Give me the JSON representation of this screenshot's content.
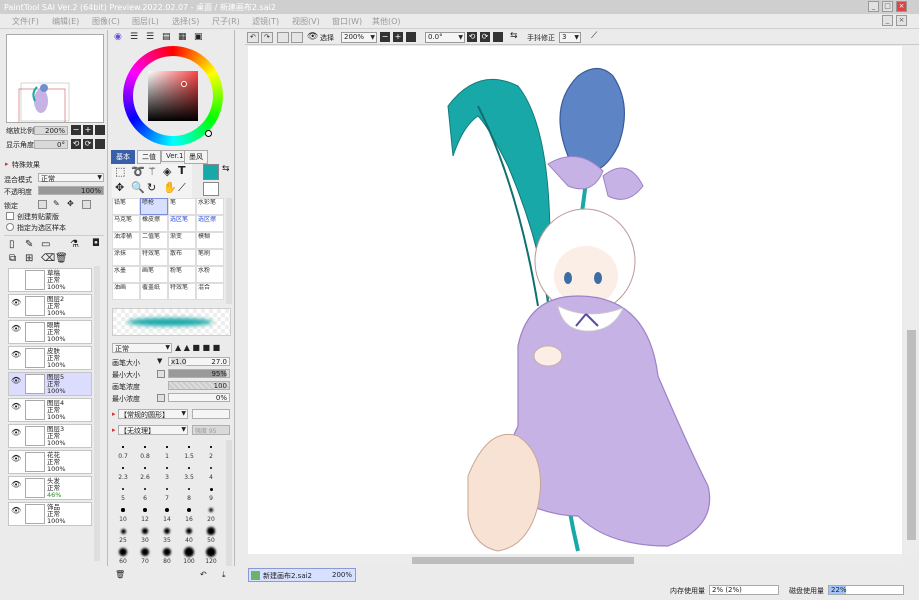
{
  "window": {
    "title": "PaintTool SAI Ver.2 (64bit) Preview.2022.02.07 - 桌面 / 新建画布2.sai2",
    "min_label": "_",
    "max_label": "□",
    "close_label": "×",
    "min2_label": "_",
    "close2_label": "×"
  },
  "menu": [
    "文件(F)",
    "编辑(E)",
    "图像(C)",
    "图层(L)",
    "选择(S)",
    "尺子(R)",
    "滤镜(T)",
    "视图(V)",
    "窗口(W)",
    "其他(O)"
  ],
  "navigator": {
    "zoom_label": "缩放比例",
    "zoom_value": "200%",
    "angle_label": "显示角度",
    "angle_value": "0°"
  },
  "layer_panel": {
    "effects_label": "特殊效果",
    "blend_label": "混合模式",
    "blend_value": "正常",
    "opacity_label": "不透明度",
    "opacity_value": "100%",
    "opacity_fraction": 1.0,
    "lock_label": "锁定",
    "clip_label": "创建剪贴蒙版",
    "sel_source_label": "指定为选区样本",
    "layers": [
      {
        "name": "草稿",
        "mode": "正常",
        "opacity": "100%",
        "visible": false
      },
      {
        "name": "图层2",
        "mode": "正常",
        "opacity": "100%",
        "visible": true
      },
      {
        "name": "眼睛",
        "mode": "正常",
        "opacity": "100%",
        "visible": true
      },
      {
        "name": "皮肤",
        "mode": "正常",
        "opacity": "100%",
        "visible": true
      },
      {
        "name": "图层5",
        "mode": "正常",
        "opacity": "100%",
        "visible": true,
        "selected": true
      },
      {
        "name": "图层4",
        "mode": "正常",
        "opacity": "100%",
        "visible": true
      },
      {
        "name": "图层3",
        "mode": "正常",
        "opacity": "100%",
        "visible": true
      },
      {
        "name": "花花",
        "mode": "正常",
        "opacity": "100%",
        "visible": true
      },
      {
        "name": "头发",
        "mode": "正常",
        "opacity": "46%",
        "visible": true
      },
      {
        "name": "饰品",
        "mode": "正常",
        "opacity": "100%",
        "visible": true
      }
    ]
  },
  "color": {
    "current": "#19a8a8",
    "wheel_center": "#2f3d3c"
  },
  "tool_tabs": [
    "基本",
    "二值",
    "Ver.1",
    "墨风"
  ],
  "tools": [
    {
      "name": "铅笔"
    },
    {
      "name": "喷枪",
      "active": true
    },
    {
      "name": "笔"
    },
    {
      "name": "水彩笔"
    },
    {
      "name": "马克笔"
    },
    {
      "name": "橡皮擦"
    },
    {
      "name": "选区笔",
      "blue": true
    },
    {
      "name": "选区擦",
      "blue": true
    },
    {
      "name": "油漆桶"
    },
    {
      "name": "二值笔"
    },
    {
      "name": "渐变"
    },
    {
      "name": "模糊"
    },
    {
      "name": "涂抹"
    },
    {
      "name": "特效笔"
    },
    {
      "name": "散布"
    },
    {
      "name": "笔刷"
    },
    {
      "name": "水墨"
    },
    {
      "name": "画笔"
    },
    {
      "name": "粉笔"
    },
    {
      "name": "水粉"
    },
    {
      "name": "油画"
    },
    {
      "name": "覆盖纸"
    },
    {
      "name": "特效笔"
    },
    {
      "name": "混合"
    }
  ],
  "brush": {
    "mode": "正常",
    "size_label": "画笔大小",
    "size_mult": "x1.0",
    "size_value": "27.0",
    "min_size_label": "最小大小",
    "min_size_value": "95%",
    "min_size_fraction": 0.95,
    "density_label": "画笔浓度",
    "density_value": "100",
    "density_fraction": 1.0,
    "min_density_label": "最小浓度",
    "min_density_value": "0%",
    "min_density_fraction": 0.0,
    "shape": "【常规的圆形】",
    "texture": "【无纹理】",
    "texture_strength": "强度 95"
  },
  "brush_sizes": [
    "0.7",
    "0.8",
    "1",
    "1.5",
    "2",
    "2.3",
    "2.6",
    "3",
    "3.5",
    "4",
    "5",
    "6",
    "7",
    "8",
    "9",
    "10",
    "12",
    "14",
    "16",
    "20",
    "25",
    "30",
    "35",
    "40",
    "50",
    "60",
    "70",
    "80",
    "100",
    "120"
  ],
  "canvas_toolbar": {
    "select_label": "选择",
    "zoom_value": "200%",
    "angle_value": "0.0°",
    "stabilizer_label": "手抖修正",
    "stabilizer_value": "3"
  },
  "status": {
    "doc_name": "新建画布2.sai2",
    "doc_zoom": "200%",
    "memory_label": "内存使用量",
    "memory_value": "2% (2%)",
    "disk_label": "磁盘使用量",
    "disk_value": "22%"
  }
}
